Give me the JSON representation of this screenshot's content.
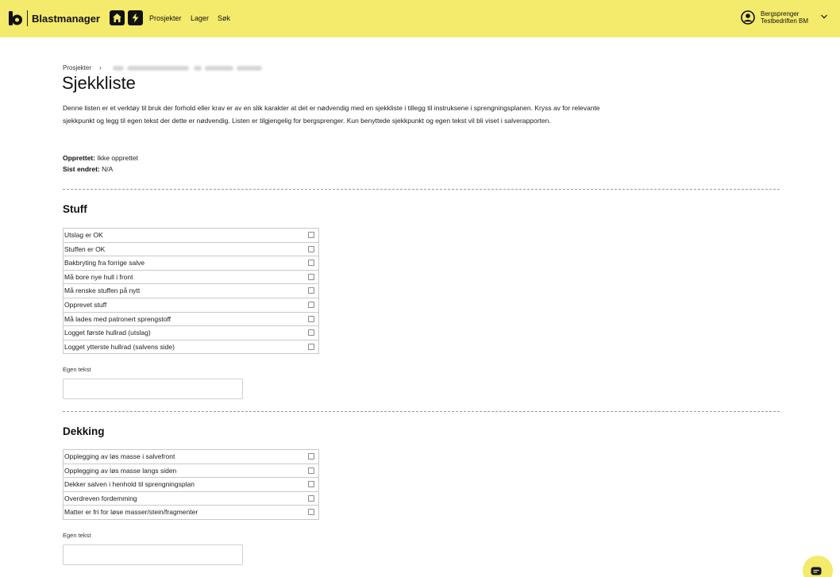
{
  "header": {
    "brand": "Blastmanager",
    "nav": {
      "home_icon": "home-icon",
      "bolt_icon": "bolt-icon",
      "projects": "Prosjekter",
      "storage": "Lager",
      "search": "Søk"
    },
    "user": {
      "icon": "user-circle-icon",
      "name": "Bergsprenger",
      "company": "Testbedriften BM"
    },
    "background_color": "#f4ea6b"
  },
  "breadcrumb": {
    "root": "Prosjekter",
    "separator": "›"
  },
  "page": {
    "title": "Sjekkliste",
    "intro": "Denne listen er et verktøy til bruk der forhold eller krav er av en slik karakter at det er nødvendig med en sjekkliste i tillegg til instruksene i sprengningsplanen. Kryss av for relevante sjekkpunkt og legg til egen tekst der dette er nødvendig. Listen er tilgjengelig for bergsprenger. Kun benyttede sjekkpunkt og egen tekst vil bli viset i salverapporten.",
    "created_label": "Opprettet:",
    "created_value": "Ikke opprettet",
    "modified_label": "Sist endret:",
    "modified_value": "N/A"
  },
  "sections": [
    {
      "title": "Stuff",
      "items": [
        "Utslag er OK",
        "Stuffen er OK",
        "Bakbryting fra forrige salve",
        "Må bore nye hull i front",
        "Må renske stuffen på nytt",
        "Opprevet stuff",
        "Må lades med patronert sprengstoff",
        "Logget første hullrad (utslag)",
        "Logget ytterste hullrad (salvens side)"
      ],
      "custom_text_label": "Egen tekst",
      "custom_text_value": ""
    },
    {
      "title": "Dekking",
      "items": [
        "Opplegging av løs masse i salvefront",
        "Opplegging av løs masse langs siden",
        "Dekker salven i henhold til sprengningsplan",
        "Overdreven fordemming",
        "Matter er fri for løse masser/stein/fragmenter"
      ],
      "custom_text_label": "Egen tekst",
      "custom_text_value": ""
    }
  ],
  "chat": {
    "icon": "chat-icon"
  }
}
